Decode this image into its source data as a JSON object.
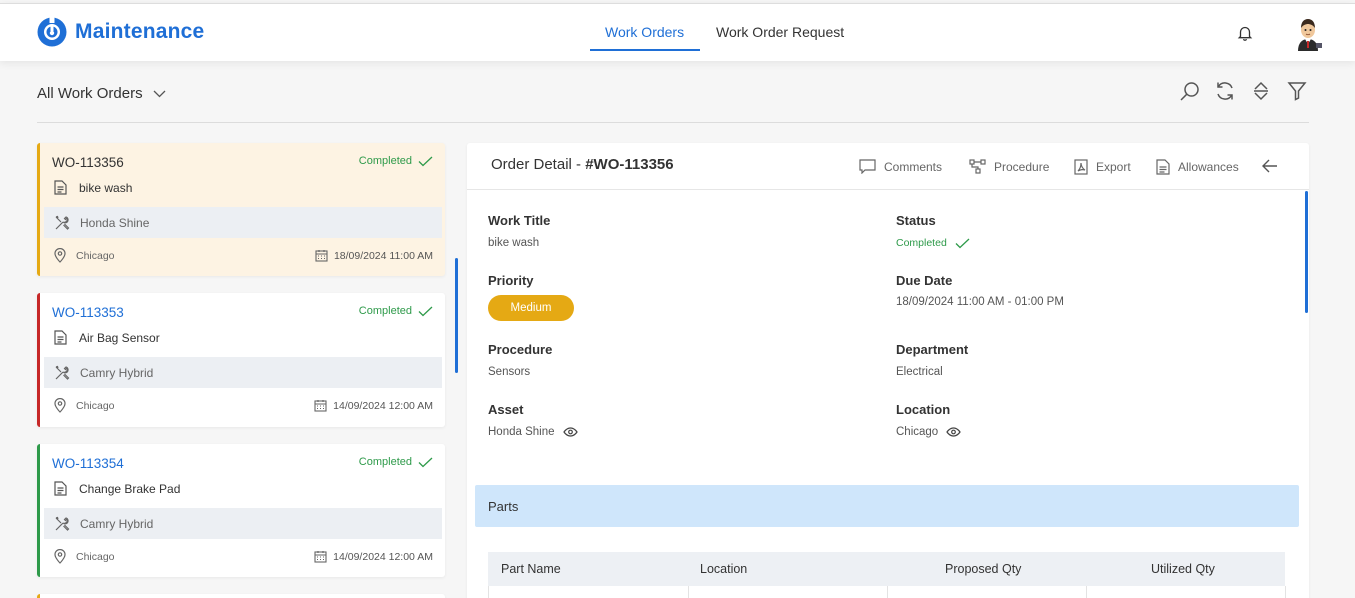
{
  "app": {
    "title": "Maintenance",
    "brand_color": "#1f6fd6"
  },
  "nav": {
    "tabs": [
      {
        "label": "Work Orders",
        "active": true
      },
      {
        "label": "Work Order Request",
        "active": false
      }
    ]
  },
  "filter": {
    "label": "All Work Orders"
  },
  "toolbar": {
    "icons": [
      "search-icon",
      "refresh-icon",
      "sort-icon",
      "filter-icon"
    ]
  },
  "work_orders": [
    {
      "code": "WO-113356",
      "status": "Completed",
      "title": "bike wash",
      "asset": "Honda Shine",
      "location": "Chicago",
      "date": "18/09/2024 11:00 AM",
      "accent": "#e5a914",
      "selected": true
    },
    {
      "code": "WO-113353",
      "status": "Completed",
      "title": "Air Bag Sensor",
      "asset": "Camry Hybrid",
      "location": "Chicago",
      "date": "14/09/2024 12:00 AM",
      "accent": "#c62828",
      "selected": false
    },
    {
      "code": "WO-113354",
      "status": "Completed",
      "title": "Change Brake Pad",
      "asset": "Camry Hybrid",
      "location": "Chicago",
      "date": "14/09/2024 12:00 AM",
      "accent": "#2e9a4a",
      "selected": false
    }
  ],
  "detail": {
    "heading": "Order Detail - ",
    "code": "#WO-113356",
    "actions": {
      "comments": "Comments",
      "procedure": "Procedure",
      "export": "Export",
      "allowances": "Allowances"
    },
    "fields": {
      "work_title": {
        "label": "Work Title",
        "value": "bike wash"
      },
      "status": {
        "label": "Status",
        "value": "Completed"
      },
      "priority": {
        "label": "Priority",
        "value": "Medium",
        "color": "#e5a914"
      },
      "due_date": {
        "label": "Due Date",
        "value": "18/09/2024 11:00 AM - 01:00 PM"
      },
      "procedure": {
        "label": "Procedure",
        "value": "Sensors"
      },
      "department": {
        "label": "Department",
        "value": "Electrical"
      },
      "asset": {
        "label": "Asset",
        "value": "Honda Shine"
      },
      "location": {
        "label": "Location",
        "value": "Chicago"
      }
    },
    "parts": {
      "title": "Parts",
      "columns": [
        "Part Name",
        "Location",
        "Proposed Qty",
        "Utilized Qty"
      ]
    }
  }
}
